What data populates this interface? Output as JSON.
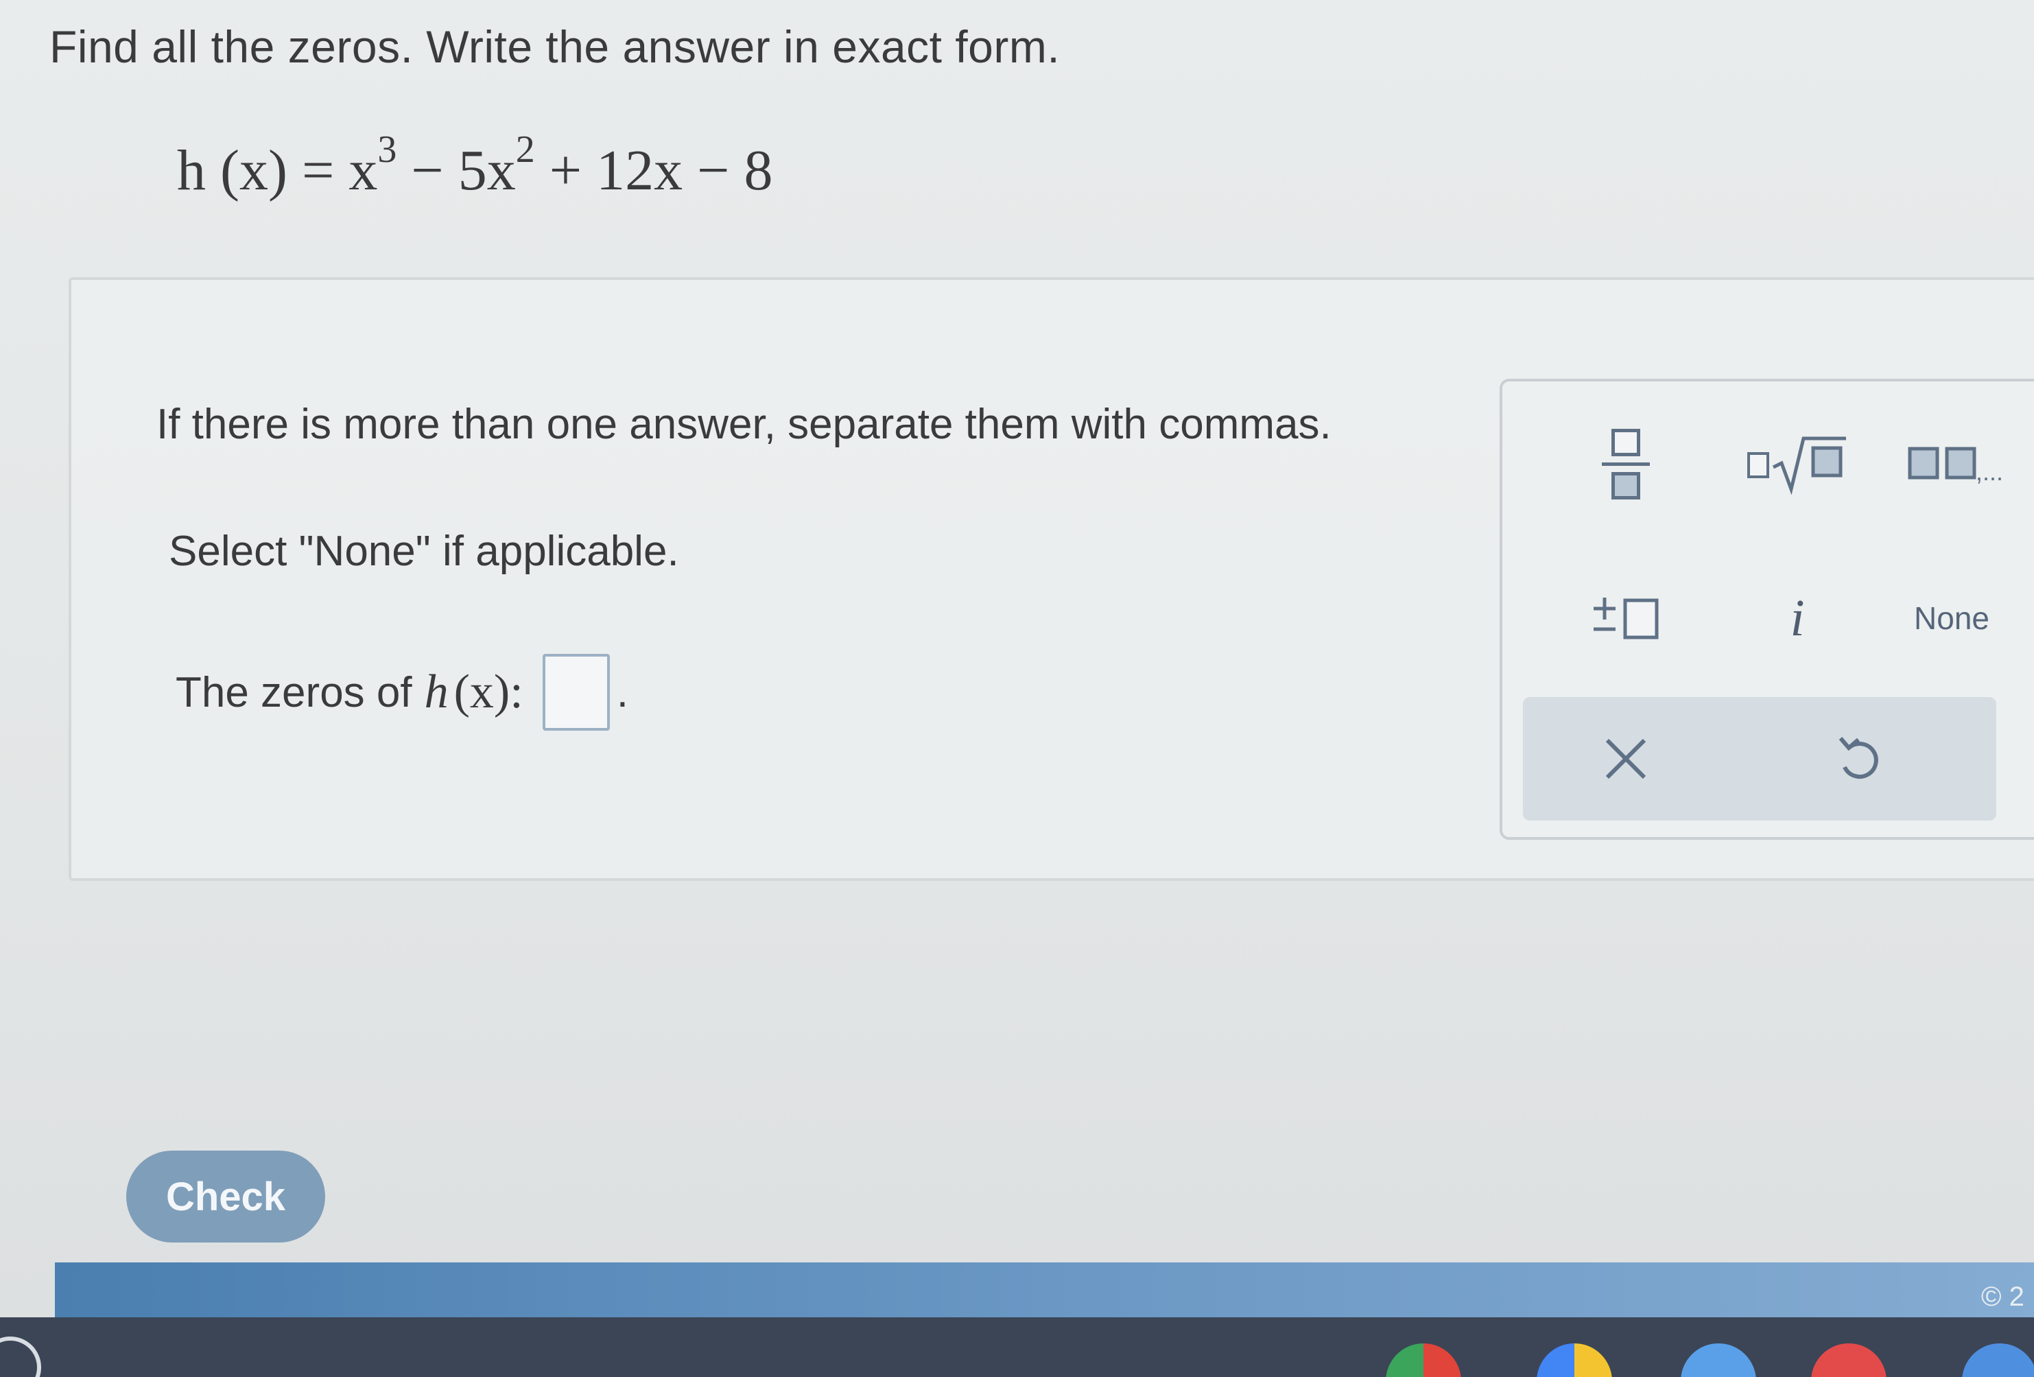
{
  "instruction": "Find all the zeros. Write the answer in exact form.",
  "equation": {
    "fn": "h (x) = ",
    "t1": "x",
    "e1": "3",
    "t2": " − 5x",
    "e2": "2",
    "t3": " + 12x − 8"
  },
  "answer_area": {
    "line1": "If there is more than one answer, separate them with commas.",
    "line2": "Select \"None\" if applicable.",
    "label": "The zeros of",
    "fn_name": "h",
    "fn_arg": "(x):",
    "value": "",
    "period": "."
  },
  "palette": {
    "imag_unit": "i",
    "none_label": "None",
    "list_suffix": ",..."
  },
  "check_label": "Check",
  "copyright": "© 2",
  "colors": {
    "check_button": "#7f9eb9",
    "palette_icon": "#5f7186",
    "footer_strip": "#4a7fb0"
  }
}
